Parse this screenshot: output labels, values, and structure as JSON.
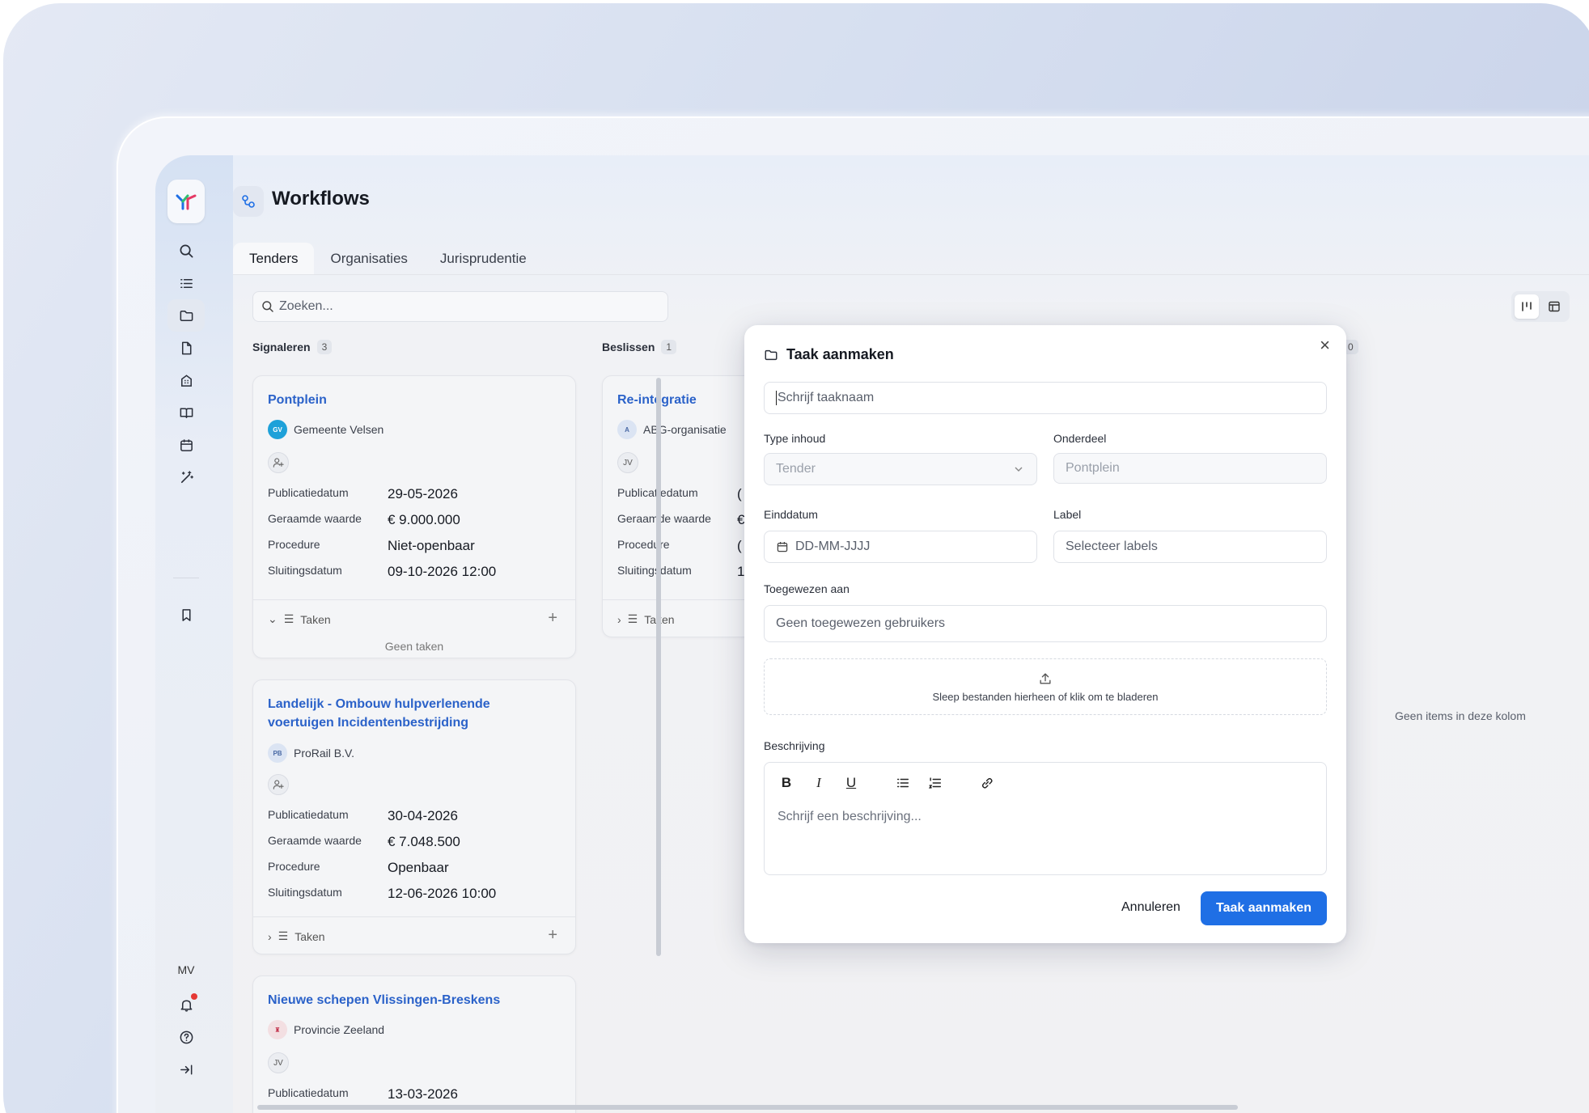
{
  "app": {
    "title": "Workflows",
    "avatar_initials": "MV"
  },
  "tabs": [
    "Tenders",
    "Organisaties",
    "Jurisprudentie"
  ],
  "search": {
    "placeholder": "Zoeken..."
  },
  "columns": [
    {
      "name": "Signaleren",
      "count": "3"
    },
    {
      "name": "Beslissen",
      "count": "1"
    }
  ],
  "far_column": {
    "count": "0",
    "empty_text": "Geen items in deze kolom"
  },
  "field_labels": {
    "pub": "Publicatiedatum",
    "value": "Geraamde waarde",
    "procedure": "Procedure",
    "closing": "Sluitingsdatum"
  },
  "taken_label": "Taken",
  "no_tasks": "Geen taken",
  "cards": [
    {
      "title": "Pontplein",
      "org": "Gemeente Velsen",
      "org_badge": "GV",
      "pub": "29-05-2026",
      "value": "€ 9.000.000",
      "procedure": "Niet-openbaar",
      "closing": "09-10-2026 12:00"
    },
    {
      "title_line1": "Landelijk - Ombouw hulpverlenende",
      "title_line2": "voertuigen Incidentenbestrijding",
      "org": "ProRail B.V.",
      "org_badge": "PB",
      "pub": "30-04-2026",
      "value": "€ 7.048.500",
      "procedure": "Openbaar",
      "closing": "12-06-2026 10:00"
    },
    {
      "title": "Nieuwe schepen Vlissingen-Breskens",
      "org": "Provincie Zeeland",
      "assignee": "JV",
      "pub": "13-03-2026"
    },
    {
      "title": "Re-integratie",
      "org": "ABG-organisatie",
      "org_badge": "A",
      "assignee": "JV",
      "pub": "(",
      "value": "€",
      "procedure": "(",
      "closing": "1"
    }
  ],
  "modal": {
    "title": "Taak aanmaken",
    "name_placeholder": "Schrijf taaknaam",
    "type_label": "Type inhoud",
    "type_value": "Tender",
    "part_label": "Onderdeel",
    "part_value": "Pontplein",
    "end_label": "Einddatum",
    "end_placeholder": "DD-MM-JJJJ",
    "labels_label": "Label",
    "labels_placeholder": "Selecteer labels",
    "assigned_label": "Toegewezen aan",
    "assigned_placeholder": "Geen toegewezen gebruikers",
    "upload_text": "Sleep bestanden hierheen of klik om te bladeren",
    "desc_label": "Beschrijving",
    "desc_placeholder": "Schrijf een beschrijving...",
    "cancel": "Annuleren",
    "submit": "Taak aanmaken"
  },
  "colors": {
    "accent": "#1f6fe5",
    "link": "#2b62c9",
    "notification": "#e53935"
  }
}
